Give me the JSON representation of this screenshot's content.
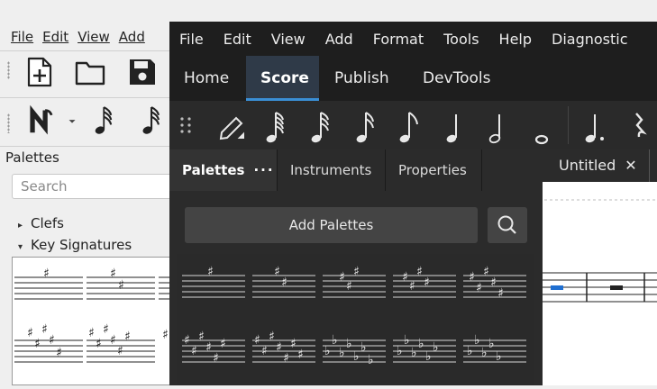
{
  "background_window": {
    "menu": [
      "File",
      "Edit",
      "View",
      "Add"
    ],
    "palettes_label": "Palettes",
    "search_placeholder": "Search",
    "tree": [
      {
        "label": "Clefs",
        "expanded": false
      },
      {
        "label": "Key Signatures",
        "expanded": true
      }
    ]
  },
  "main_window": {
    "menu": [
      "File",
      "Edit",
      "View",
      "Add",
      "Format",
      "Tools",
      "Help",
      "Diagnostic"
    ],
    "tabs": [
      {
        "label": "Home",
        "active": false
      },
      {
        "label": "Score",
        "active": true
      },
      {
        "label": "Publish",
        "active": false
      },
      {
        "label": "DevTools",
        "active": false
      }
    ],
    "note_toolbar_icons": [
      "grip-icon",
      "pencil-icon",
      "64th-note-icon",
      "32nd-note-icon",
      "16th-note-icon",
      "eighth-note-icon",
      "quarter-note-icon",
      "half-note-icon",
      "whole-note-icon",
      "dotted-note-icon",
      "rest-icon"
    ],
    "panel_tabs": [
      {
        "label": "Palettes",
        "active": true,
        "menu": "···"
      },
      {
        "label": "Instruments",
        "active": false
      },
      {
        "label": "Properties",
        "active": false
      }
    ],
    "add_palettes_label": "Add Palettes",
    "score_tab": {
      "title": "Untitled",
      "close": "✕"
    },
    "key_signature_cells": [
      "1 sharp",
      "2 sharps",
      "3 sharps",
      "4 sharps",
      "5 sharps",
      "6 sharps",
      "7 sharps",
      "7 flats",
      "6 flats",
      "5 flats"
    ]
  },
  "colors": {
    "accent": "#3a8fd6",
    "dark_bg": "#2b2b2b",
    "menubar_bg": "#1e1e1e"
  }
}
